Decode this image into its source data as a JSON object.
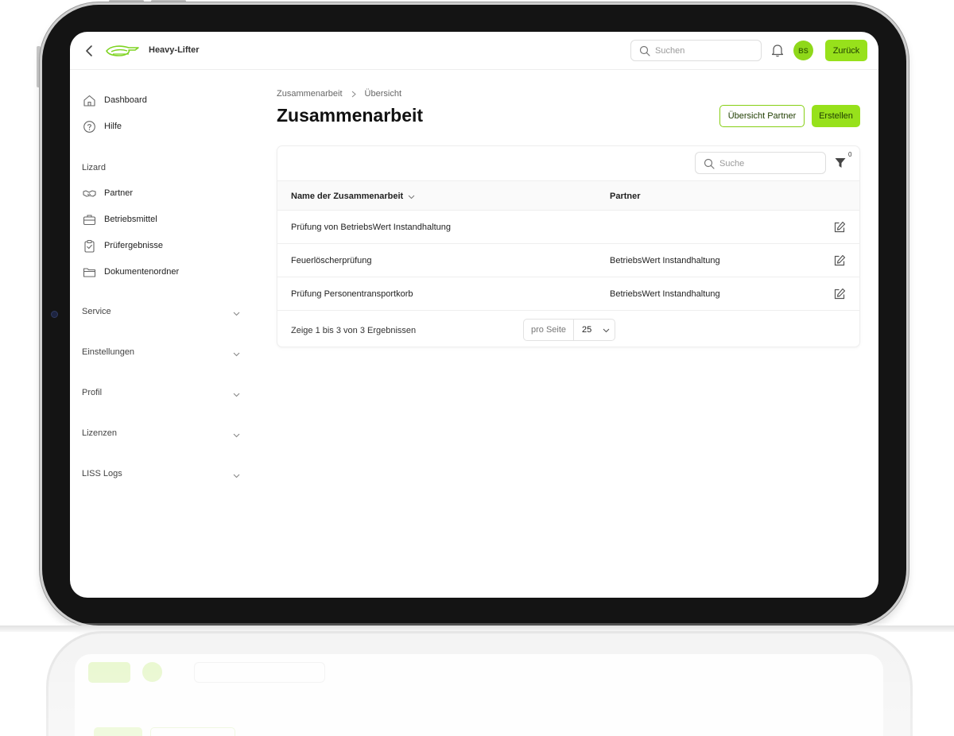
{
  "app": {
    "brand": "Heavy-Lifter",
    "accent": "#97e11b"
  },
  "header": {
    "search_placeholder": "Suchen",
    "avatar_initials": "BS",
    "back_label": "Zurück"
  },
  "sidebar": {
    "top_items": [
      {
        "label": "Dashboard",
        "icon": "home-icon"
      },
      {
        "label": "Hilfe",
        "icon": "help-icon"
      }
    ],
    "group_label": "Lizard",
    "group_items": [
      {
        "label": "Partner",
        "icon": "handshake-icon"
      },
      {
        "label": "Betriebsmittel",
        "icon": "toolbox-icon"
      },
      {
        "label": "Prüfergebnisse",
        "icon": "clipboard-check-icon"
      },
      {
        "label": "Dokumentenordner",
        "icon": "folder-icon"
      }
    ],
    "sections": [
      "Service",
      "Einstellungen",
      "Profil",
      "Lizenzen",
      "LISS Logs"
    ]
  },
  "main": {
    "breadcrumb": [
      "Zusammenarbeit",
      "Übersicht"
    ],
    "title": "Zusammenarbeit",
    "overview_partner_label": "Übersicht Partner",
    "create_label": "Erstellen",
    "table": {
      "search_placeholder": "Suche",
      "filter_count": "0",
      "columns": [
        "Name der Zusammenarbeit",
        "Partner"
      ],
      "rows": [
        {
          "name": "Prüfung von BetriebsWert Instandhaltung",
          "partner": ""
        },
        {
          "name": "Feuerlöscherprüfung",
          "partner": "BetriebsWert Instandhaltung"
        },
        {
          "name": "Prüfung Personentransportkorb",
          "partner": "BetriebsWert Instandhaltung"
        }
      ],
      "summary": "Zeige 1 bis 3 von 3 Ergebnissen",
      "per_page_label": "pro Seite",
      "per_page_value": "25"
    }
  }
}
